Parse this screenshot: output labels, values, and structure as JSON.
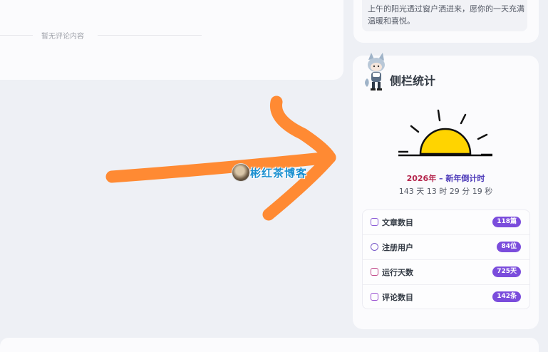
{
  "comments": {
    "empty_text": "暂无评论内容"
  },
  "greeting": {
    "text": "上午的阳光透过窗户洒进来，愿你的一天充满温暖和喜悦。"
  },
  "sidebar": {
    "title": "侧栏统计",
    "countdown": {
      "year": "2026年",
      "separator": " – ",
      "label": "新年倒计时",
      "time": "143 天 13 时 29 分 19 秒"
    },
    "stats": [
      {
        "label": "文章数目",
        "value": "118篇",
        "icon": "article-icon",
        "color": "#8a5bd6"
      },
      {
        "label": "注册用户",
        "value": "84位",
        "icon": "user-icon",
        "color": "#7a5bc8"
      },
      {
        "label": "运行天数",
        "value": "725天",
        "icon": "calendar-icon",
        "color": "#c0488a"
      },
      {
        "label": "评论数目",
        "value": "142条",
        "icon": "comment-icon",
        "color": "#9a4fd0"
      }
    ]
  },
  "blog": {
    "name": "彬红茶博客"
  },
  "colors": {
    "accent": "#7b4ddc",
    "arrow": "#ff8a33",
    "sun": "#ffd400"
  }
}
